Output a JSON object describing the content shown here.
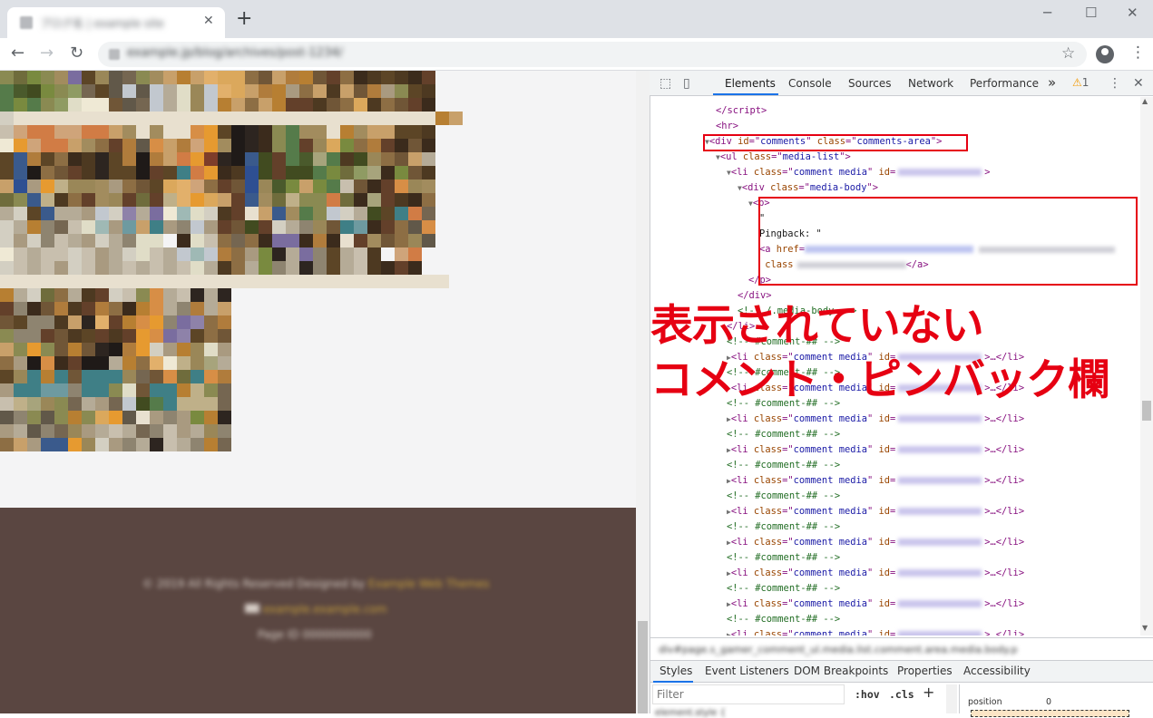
{
  "browser": {
    "tab_title": "ブログ名 | example site",
    "url": "example.jp/blog/archives/post-1234/",
    "icons": {
      "back": "arrow-left-icon",
      "forward": "arrow-right-icon",
      "reload": "reload-icon",
      "star": "star-icon",
      "profile": "profile-icon",
      "menu": "kebab-menu-icon",
      "close_tab": "close-icon",
      "new_tab": "plus-icon"
    },
    "window_controls": {
      "minimize": "─",
      "maximize": "☐",
      "close": "✕"
    }
  },
  "page": {
    "footer_lines": [
      {
        "text": "© 2019 All Rights Reserved Designed by ",
        "link": "Example Web Themes"
      },
      {
        "text": "",
        "link": "example.example.com"
      },
      {
        "text": "Page ID 0000000000",
        "link": ""
      }
    ],
    "mosaic_colors": {
      "A": "#6f6c3c",
      "B": "#8a8a52",
      "C": "#a28c5e",
      "D": "#c8a06a",
      "E": "#dba85c",
      "F": "#e2b06b",
      "G": "#b07c3c",
      "H": "#5c4526",
      "I": "#3b2b1c",
      "J": "#2d2520",
      "K": "#8d6e44",
      "L": "#d78e46",
      "M": "#e69a30",
      "N": "#b77f32",
      "O": "#63402a",
      "P": "#4d3921",
      "Q": "#705637",
      "R": "#a99a80",
      "S": "#c8bfae",
      "T": "#d3cfc2",
      "U": "#b5ab97",
      "V": "#8e8470",
      "W": "#756651",
      "X": "#3a5a8c",
      "Y": "#2e4f92",
      "Z": "#557b4a",
      "a": "#798a3f",
      "b": "#414b20",
      "c": "#4a5a2c",
      "d": "#9a8758",
      "e": "#bfb089",
      "f": "#e0ddc7",
      "g": "#6e9aa0",
      "h": "#3f7f86",
      "i": "#8e82a9",
      "j": "#7a6d9f",
      "k": "#9fb9b5",
      "l": "#c2c8cf",
      "m": "#efe9d5",
      "n": "#cfa47a",
      "o": "#d17c45",
      "p": "#f2f2f3",
      "q": "#e8e0cf",
      "r": "#615849",
      "s": "#7e3d2a",
      "t": "#1f1a18",
      "u": "#a7a47c",
      "v": "#8f9b63"
    },
    "mosaic_rows": [
      "BAaBCjHdrWBCDNDFEEKQDGNQOKIPHPIOppp",
      "ZcbaBvWHrlrlUfdlFEDGNRKDPDQGRBHPppp",
      "ZaZBvfmmQrWlUfdlNDKDNOOPQKEPKQOIppp",
      "TqqqqqqqqqqqqqqqqqqqqqqqqqqqqqqqNDp",
      "SnoonnooDCqCqqLMHtJIBZCCqNCDDHHPppp",
      "mMnooDCKOGrLDGnMCtJIBZOdEaKGOIQIppp",
      "HXGHKIPJHGtGDoMsJtXbOZcuZPbdKQDUppp",
      "HXtKQOPJHHtOHhoMIPYbObbZaAvuIaQPppp",
      "DYRMeddCRKQHEFnKOQYdcaDaZSQIOLdCppp",
      "ABXePKOCdOAOeFMEDOXCAeBBoAIuOPIKppp",
      "UTHXUURlTiUjmkfTPOqDXCZBlTUbHhoWppp",
      "TUNVWSfkRgDhRVlROQbOTUVdQhgIOKrLppp",
      "TRTVSURTUVffpIfSKWKIjjIGIqOCQKdrppp",
      "mSUSSTSRUTfSUlklGKRaJUjVHUSPpnoppp",
      "TSUSRTSRUSUSUSfUPKUaVUJVHUSPIOIppp",
      "qqqqqqqqqqqqqqqqqqqqqqqqqqqqqqqqqpp",
      "NUTAKUPOTSBLUSJUJppppppppppppppppp",
      "OVIQGPOGKINLUVGUDppppppppppppppppp",
      "QHVVPDJFONLMVjiKGppppppppppppppppp",
      "BVVOQPHOPOMLjiHKQppppppppppppppppp",
      "DBMBQNQJtGMTRNdfRppppppppppppppppp",
      "KRtLIOttUNKFmeduUppppppppppppppppp",
      "HdhNhQhhhdWQLAhLGppppppppppppppppp",
      "RhhggVhhBfQhhNeBWppppppppppppppppp",
      "SeudBWURWlbZheeeWppppppppppppppppp",
      "rVBrBNBEMrqRVRaNJppppppppppppppppp",
      "RUrVWdRUSUWVSRUdVppppppppppppppppp",
      "KDRXXMdTRVUJSUVNWppppppppppppppppp"
    ]
  },
  "devtools": {
    "tabs": [
      "Elements",
      "Console",
      "Sources",
      "Network",
      "Performance"
    ],
    "more_tabs": "»",
    "warning_count": "1",
    "icons": {
      "inspect": "inspect-element-icon",
      "device": "device-toolbar-icon",
      "warning": "warning-icon",
      "settings": "kebab-menu-icon",
      "close": "close-icon"
    },
    "dom_lines": [
      {
        "indent": 6,
        "html": "<span class='tg'>&lt;/script&gt;</span>"
      },
      {
        "indent": 6,
        "html": "<span class='tg'>&lt;hr&gt;</span>"
      },
      {
        "indent": 5,
        "html": "<span class='tri'>▼</span><span class='tg'>&lt;div </span><span class='an'>id</span><span class='tg'>=\"</span><span class='av'>comments</span><span class='tg'>\" </span><span class='an'>class</span><span class='tg'>=\"</span><span class='av'>comments-area</span><span class='tg'>\"&gt;</span>"
      },
      {
        "indent": 6,
        "html": "<span class='tri'>▼</span><span class='tg'>&lt;ul </span><span class='an'>class</span><span class='tg'>=\"</span><span class='av'>media-list</span><span class='tg'>\"&gt;</span>"
      },
      {
        "indent": 7,
        "html": "<span class='tri'>▼</span><span class='tg'>&lt;li </span><span class='an'>class</span><span class='tg'>=\"</span><span class='av'>comment media</span><span class='tg'>\" </span><span class='an'>id</span><span class='tg'>=</span><span class='blur-id'></span><span class='tg'>&gt;</span>"
      },
      {
        "indent": 8,
        "html": "<span class='tri'>▼</span><span class='tg'>&lt;div </span><span class='an'>class</span><span class='tg'>=\"</span><span class='av'>media-body</span><span class='tg'>\"&gt;</span>"
      },
      {
        "indent": 9,
        "html": "<span class='tri'>▼</span><span class='tg'>&lt;p&gt;</span>"
      },
      {
        "indent": 10,
        "html": "<span class='tx'>\"</span>"
      },
      {
        "indent": 10,
        "html": "<span class='tx'>                          Pingback: \"</span>"
      },
      {
        "indent": 10,
        "html": "<span class='tg'>&lt;a </span><span class='an'>href</span><span class='tg'>=</span><span class='blur-href' style='width:186px'></span><span class='blur-grey' style='width:150px;margin-left:6px'></span>"
      },
      {
        "indent": 10,
        "html": "<span class='an'>&nbsp;class</span><span class='blur-grey' style='width:120px;margin-left:4px'></span><span class='tg'>&lt;/a&gt;</span>"
      },
      {
        "indent": 9,
        "html": "<span class='tg'>&lt;/p&gt;</span>"
      },
      {
        "indent": 8,
        "html": "<span class='tg'>&lt;/div&gt;</span>"
      },
      {
        "indent": 8,
        "html": "<span class='cm'>&lt;!-- /.media-body --&gt;</span>"
      },
      {
        "indent": 7,
        "html": "<span class='tg'>&lt;/li&gt;</span>"
      },
      {
        "indent": 7,
        "html": "<span class='cm'>&lt;!-- #comment-## --&gt;</span>"
      },
      {
        "indent": 7,
        "html": "<span class='tri'>▶</span><span class='tg'>&lt;li </span><span class='an'>class</span><span class='tg'>=\"</span><span class='av'>comment media</span><span class='tg'>\" </span><span class='an'>id</span><span class='tg'>=</span><span class='blur-id'></span><span class='tg'>&gt;…&lt;/li&gt;</span>"
      },
      {
        "indent": 7,
        "html": "<span class='cm'>&lt;!-- #comment-## --&gt;</span>"
      },
      {
        "indent": 7,
        "html": "<span class='tri'>▶</span><span class='tg'>&lt;li </span><span class='an'>class</span><span class='tg'>=\"</span><span class='av'>comment media</span><span class='tg'>\" </span><span class='an'>id</span><span class='tg'>=</span><span class='blur-id'></span><span class='tg'>&gt;…&lt;/li&gt;</span>"
      },
      {
        "indent": 7,
        "html": "<span class='cm'>&lt;!-- #comment-## --&gt;</span>"
      },
      {
        "indent": 7,
        "html": "<span class='tri'>▶</span><span class='tg'>&lt;li </span><span class='an'>class</span><span class='tg'>=\"</span><span class='av'>comment media</span><span class='tg'>\" </span><span class='an'>id</span><span class='tg'>=</span><span class='blur-id'></span><span class='tg'>&gt;…&lt;/li&gt;</span>"
      },
      {
        "indent": 7,
        "html": "<span class='cm'>&lt;!-- #comment-## --&gt;</span>"
      },
      {
        "indent": 7,
        "html": "<span class='tri'>▶</span><span class='tg'>&lt;li </span><span class='an'>class</span><span class='tg'>=\"</span><span class='av'>comment media</span><span class='tg'>\" </span><span class='an'>id</span><span class='tg'>=</span><span class='blur-id'></span><span class='tg'>&gt;…&lt;/li&gt;</span>"
      },
      {
        "indent": 7,
        "html": "<span class='cm'>&lt;!-- #comment-## --&gt;</span>"
      },
      {
        "indent": 7,
        "html": "<span class='tri'>▶</span><span class='tg'>&lt;li </span><span class='an'>class</span><span class='tg'>=\"</span><span class='av'>comment media</span><span class='tg'>\" </span><span class='an'>id</span><span class='tg'>=</span><span class='blur-id'></span><span class='tg'>&gt;…&lt;/li&gt;</span>"
      },
      {
        "indent": 7,
        "html": "<span class='cm'>&lt;!-- #comment-## --&gt;</span>"
      },
      {
        "indent": 7,
        "html": "<span class='tri'>▶</span><span class='tg'>&lt;li </span><span class='an'>class</span><span class='tg'>=\"</span><span class='av'>comment media</span><span class='tg'>\" </span><span class='an'>id</span><span class='tg'>=</span><span class='blur-id'></span><span class='tg'>&gt;…&lt;/li&gt;</span>"
      },
      {
        "indent": 7,
        "html": "<span class='cm'>&lt;!-- #comment-## --&gt;</span>"
      },
      {
        "indent": 7,
        "html": "<span class='tri'>▶</span><span class='tg'>&lt;li </span><span class='an'>class</span><span class='tg'>=\"</span><span class='av'>comment media</span><span class='tg'>\" </span><span class='an'>id</span><span class='tg'>=</span><span class='blur-id'></span><span class='tg'>&gt;…&lt;/li&gt;</span>"
      },
      {
        "indent": 7,
        "html": "<span class='cm'>&lt;!-- #comment-## --&gt;</span>"
      },
      {
        "indent": 7,
        "html": "<span class='tri'>▶</span><span class='tg'>&lt;li </span><span class='an'>class</span><span class='tg'>=\"</span><span class='av'>comment media</span><span class='tg'>\" </span><span class='an'>id</span><span class='tg'>=</span><span class='blur-id'></span><span class='tg'>&gt;…&lt;/li&gt;</span>"
      },
      {
        "indent": 7,
        "html": "<span class='cm'>&lt;!-- #comment-## --&gt;</span>"
      },
      {
        "indent": 7,
        "html": "<span class='tri'>▶</span><span class='tg'>&lt;li </span><span class='an'>class</span><span class='tg'>=\"</span><span class='av'>comment media</span><span class='tg'>\" </span><span class='an'>id</span><span class='tg'>=</span><span class='blur-id'></span><span class='tg'>&gt;…&lt;/li&gt;</span>"
      },
      {
        "indent": 7,
        "html": "<span class='cm'>&lt;!-- #comment-## --&gt;</span>"
      },
      {
        "indent": 7,
        "html": "<span class='tri'>▶</span><span class='tg'>&lt;li </span><span class='an'>class</span><span class='tg'>=\"</span><span class='av'>comment media</span><span class='tg'>\" </span><span class='an'>id</span><span class='tg'>=</span><span class='blur-id'></span><span class='tg'>&gt;…&lt;/li&gt;</span>"
      }
    ],
    "breadcrumb_text": "div#page.s_gamer_comment_ul.media.list.comment.area.media.body.p",
    "sub_tabs": [
      "Styles",
      "Event Listeners",
      "DOM Breakpoints",
      "Properties",
      "Accessibility"
    ],
    "filter_placeholder": "Filter",
    "hov_label": ":hov",
    "cls_label": ".cls",
    "add_rule": "+",
    "box_model": {
      "label": "position",
      "value": "0"
    },
    "element_styles_partial": "element.style {"
  },
  "annotation": {
    "line1": "表示されていない",
    "line2": "コメント・ピンバック欄",
    "color": "#e60012"
  }
}
